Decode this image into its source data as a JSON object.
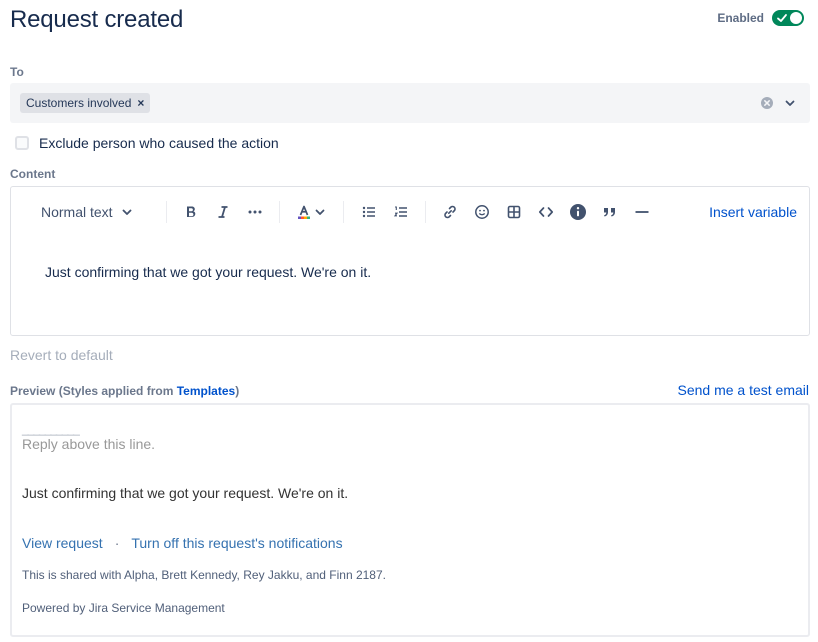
{
  "header": {
    "title": "Request created",
    "enabled_label": "Enabled",
    "enabled": true
  },
  "to": {
    "label": "To",
    "tags": [
      "Customers involved"
    ],
    "tag_remove": "×"
  },
  "exclude": {
    "label": "Exclude person who caused the action",
    "checked": false
  },
  "content": {
    "label": "Content",
    "toolbar": {
      "text_style": "Normal text",
      "insert_variable": "Insert variable",
      "icons": [
        "bold-icon",
        "italic-icon",
        "more-formatting-icon",
        "text-color-icon",
        "bullet-list-icon",
        "numbered-list-icon",
        "link-icon",
        "emoji-icon",
        "table-icon",
        "code-icon",
        "info-panel-icon",
        "quote-icon",
        "divider-icon"
      ]
    },
    "body": "Just confirming that we got your request. We're on it."
  },
  "revert_label": "Revert to default",
  "preview": {
    "label_prefix": "Preview (Styles applied from ",
    "label_link": "Templates",
    "label_suffix": ")",
    "send_test": "Send me a test email",
    "divider": "__________",
    "reply_line": "Reply above this line.",
    "body": "Just confirming that we got your request. We're on it.",
    "view_request": "View request",
    "dot": "·",
    "turn_off": "Turn off this request's notifications",
    "shared": "This is shared with Alpha, Brett Kennedy, Rey Jakku, and Finn 2187.",
    "powered": "Powered by Jira Service Management"
  },
  "colors": {
    "accent": "#0052cc",
    "toggle_on": "#00875a",
    "heading": "#172b4d"
  }
}
